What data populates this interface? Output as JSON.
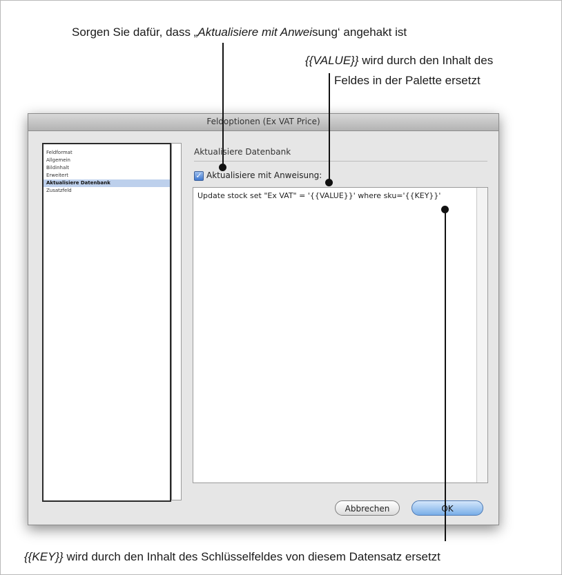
{
  "annotations": {
    "top_pre": "Sorgen Sie dafür, dass „",
    "top_italic": "Aktualisiere mit Anwei",
    "top_post": "sung‘ angehakt ist",
    "value_italic": "{{VALUE}}",
    "value_rest": " wird durch den Inhalt des",
    "value_line2": "Feldes in der Palette ersetzt",
    "key_italic": "{{KEY}}",
    "key_rest": " wird durch den Inhalt des Schlüsselfeldes von diesem Datensatz ersetzt"
  },
  "dialog": {
    "title": "Feldoptionen (Ex VAT Price)",
    "sidebar_items": [
      {
        "label": "Feldformat"
      },
      {
        "label": "Allgemein"
      },
      {
        "label": "Bildinhalt"
      },
      {
        "label": "Erweitert"
      },
      {
        "label": "Aktualisiere Datenbank",
        "selected": true
      },
      {
        "label": "Zusatzfeld"
      }
    ],
    "section_title": "Aktualisiere Datenbank",
    "checkbox_label": "Aktualisiere mit Anweisung:",
    "checkbox_checked": true,
    "statement": "Update stock set \"Ex VAT\" = '{{VALUE}}' where sku='{{KEY}}'",
    "cancel_label": "Abbrechen",
    "ok_label": "OK"
  }
}
